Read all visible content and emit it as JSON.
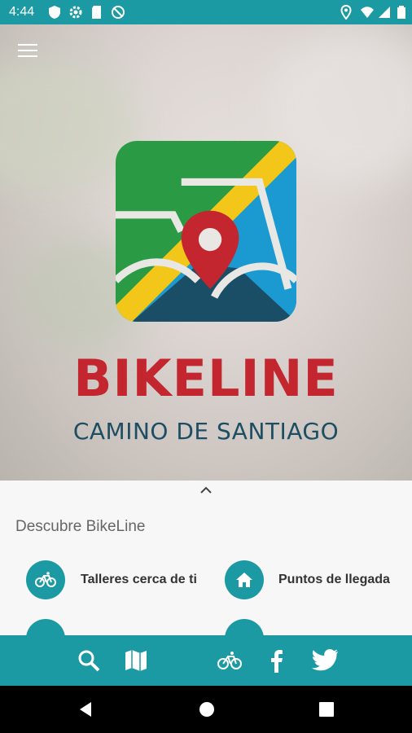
{
  "status_bar": {
    "time": "4:44"
  },
  "hero": {
    "brand": "BIKELINE",
    "tagline": "CAMINO DE SANTIAGO"
  },
  "sheet": {
    "title": "Descubre BikeLine",
    "items": [
      {
        "label": "Talleres cerca de ti",
        "icon": "bicycle-icon"
      },
      {
        "label": "Puntos de llegada",
        "icon": "home-icon"
      }
    ]
  },
  "tabbar": {
    "icons": [
      "search-icon",
      "map-icon",
      "bicycle-icon",
      "facebook-icon",
      "twitter-icon"
    ]
  },
  "colors": {
    "accent": "#1c9aa3",
    "brand_red": "#c3262e",
    "brand_navy": "#1d4d63"
  }
}
